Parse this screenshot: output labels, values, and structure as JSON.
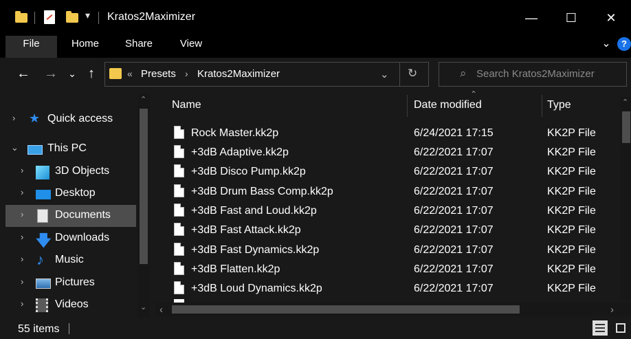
{
  "window": {
    "title": "Kratos2Maximizer",
    "minimize_glyph": "—",
    "maximize_glyph": "☐",
    "close_glyph": "✕",
    "qat_dropdown_glyph": "▾"
  },
  "ribbon": {
    "tabs": [
      {
        "label": "File"
      },
      {
        "label": "Home"
      },
      {
        "label": "Share"
      },
      {
        "label": "View"
      }
    ],
    "expand_glyph": "⌄",
    "help_glyph": "?"
  },
  "nav": {
    "back_glyph": "←",
    "forward_glyph": "→",
    "recent_glyph": "⌄",
    "up_glyph": "↑",
    "overflow_glyph": "«",
    "breadcrumbs": [
      {
        "label": "Presets"
      },
      {
        "label": "Kratos2Maximizer"
      }
    ],
    "crumb_separator": "›",
    "dropdown_glyph": "⌄",
    "refresh_glyph": "↻",
    "search_placeholder": "Search Kratos2Maximizer",
    "search_glyph": "⌕"
  },
  "sidebar": {
    "items": [
      {
        "label": "Quick access",
        "icon": "star-icon"
      },
      {
        "label": "This PC",
        "icon": "computer-icon"
      },
      {
        "label": "3D Objects",
        "icon": "cube-icon"
      },
      {
        "label": "Desktop",
        "icon": "desktop-icon"
      },
      {
        "label": "Documents",
        "icon": "document-icon"
      },
      {
        "label": "Downloads",
        "icon": "download-icon"
      },
      {
        "label": "Music",
        "icon": "music-icon"
      },
      {
        "label": "Pictures",
        "icon": "pictures-icon"
      },
      {
        "label": "Videos",
        "icon": "videos-icon"
      }
    ],
    "collapsed_glyph": "›",
    "expanded_glyph": "⌄"
  },
  "list": {
    "columns": [
      {
        "label": "Name"
      },
      {
        "label": "Date modified"
      },
      {
        "label": "Type"
      }
    ],
    "sort_glyph": "⌃",
    "rows": [
      {
        "name": "Rock Master.kk2p",
        "date": "6/24/2021 17:15",
        "type": "KK2P File"
      },
      {
        "name": "+3dB Adaptive.kk2p",
        "date": "6/22/2021 17:07",
        "type": "KK2P File"
      },
      {
        "name": "+3dB Disco Pump.kk2p",
        "date": "6/22/2021 17:07",
        "type": "KK2P File"
      },
      {
        "name": "+3dB Drum Bass Comp.kk2p",
        "date": "6/22/2021 17:07",
        "type": "KK2P File"
      },
      {
        "name": "+3dB Fast and Loud.kk2p",
        "date": "6/22/2021 17:07",
        "type": "KK2P File"
      },
      {
        "name": "+3dB Fast Attack.kk2p",
        "date": "6/22/2021 17:07",
        "type": "KK2P File"
      },
      {
        "name": "+3dB Fast Dynamics.kk2p",
        "date": "6/22/2021 17:07",
        "type": "KK2P File"
      },
      {
        "name": "+3dB Flatten.kk2p",
        "date": "6/22/2021 17:07",
        "type": "KK2P File"
      },
      {
        "name": "+3dB Loud Dynamics.kk2p",
        "date": "6/22/2021 17:07",
        "type": "KK2P File"
      }
    ]
  },
  "scroll": {
    "up_glyph": "⌃",
    "down_glyph": "⌄",
    "left_glyph": "‹",
    "right_glyph": "›"
  },
  "status": {
    "item_count": "55 items"
  }
}
